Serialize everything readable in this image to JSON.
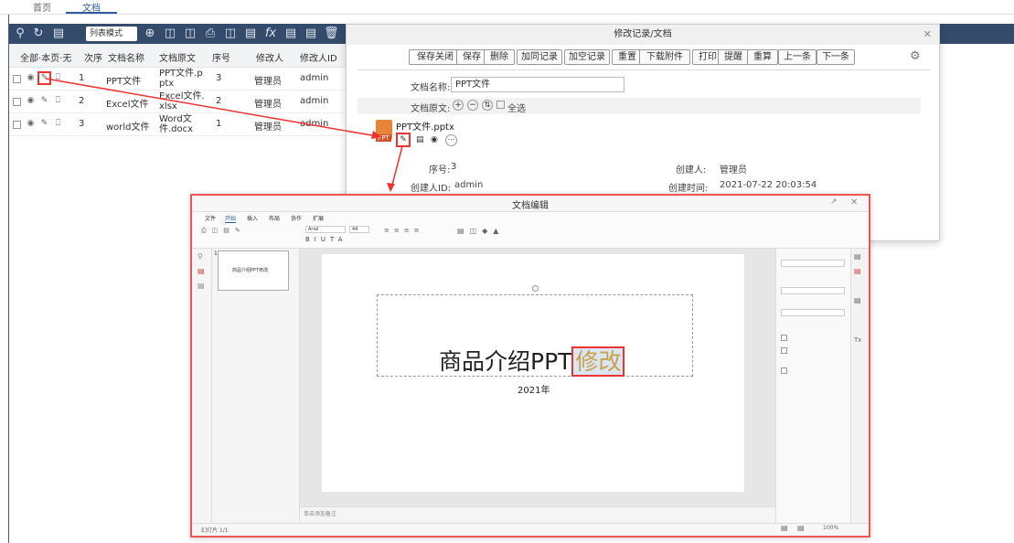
{
  "tabs": [
    "首页",
    "文档"
  ],
  "toolbar": {
    "mode": "列表模式"
  },
  "grid": {
    "headers": [
      "全部·本页·无",
      "次序",
      "文档名称",
      "文档原文",
      "序号",
      "修改人",
      "修改人ID"
    ],
    "rows": [
      {
        "order": "1",
        "name": "PPT文件",
        "file1": "PPT文件.p",
        "file2": "ptx",
        "seq": "3",
        "modifier": "管理员",
        "mid": "admin"
      },
      {
        "order": "2",
        "name": "Excel文件",
        "file1": "Excel文件.",
        "file2": "xlsx",
        "seq": "2",
        "modifier": "管理员",
        "mid": "admin"
      },
      {
        "order": "3",
        "name": "world文件",
        "file1": "Word文",
        "file2": "件.docx",
        "seq": "1",
        "modifier": "管理员",
        "mid": "admin"
      }
    ]
  },
  "dialog": {
    "title": "修改记录/文档",
    "buttons": [
      "保存关闭",
      "保存",
      "删除",
      "加同记录",
      "加空记录",
      "重置",
      "下载附件",
      "打印",
      "提醒",
      "重算",
      "上一条",
      "下一条"
    ],
    "name_label": "文档名称:",
    "name_value": "PPT文件",
    "orig_label": "文档原文:",
    "select_all": "全选",
    "file_name": "PPT文件.pptx",
    "file_badge": "PPT",
    "seq_label": "序号:",
    "seq_value": "3",
    "creator_label": "创建人:",
    "creator_value": "管理员",
    "creator_id_label": "创建人ID:",
    "creator_id_value": "admin",
    "created_label": "创建时间:",
    "created_value": "2021-07-22 20:03:54"
  },
  "editor": {
    "title": "文档编辑",
    "menu": [
      "文件",
      "开始",
      "插入",
      "布局",
      "协作",
      "扩展"
    ],
    "font": "Arial",
    "font_size": "44",
    "thumb_num": "1",
    "thumb_text": "商品介绍PPT修改",
    "slide_title_main": "商品介绍PPT",
    "slide_title_edit": "修改",
    "slide_sub": "2021年",
    "notes": "单击添加备注",
    "status": "幻灯片 1/1",
    "zoom": "100%"
  },
  "colors": {
    "toolbar": "#354b6c",
    "accent": "#e33",
    "highlight": "#c9a24a"
  }
}
